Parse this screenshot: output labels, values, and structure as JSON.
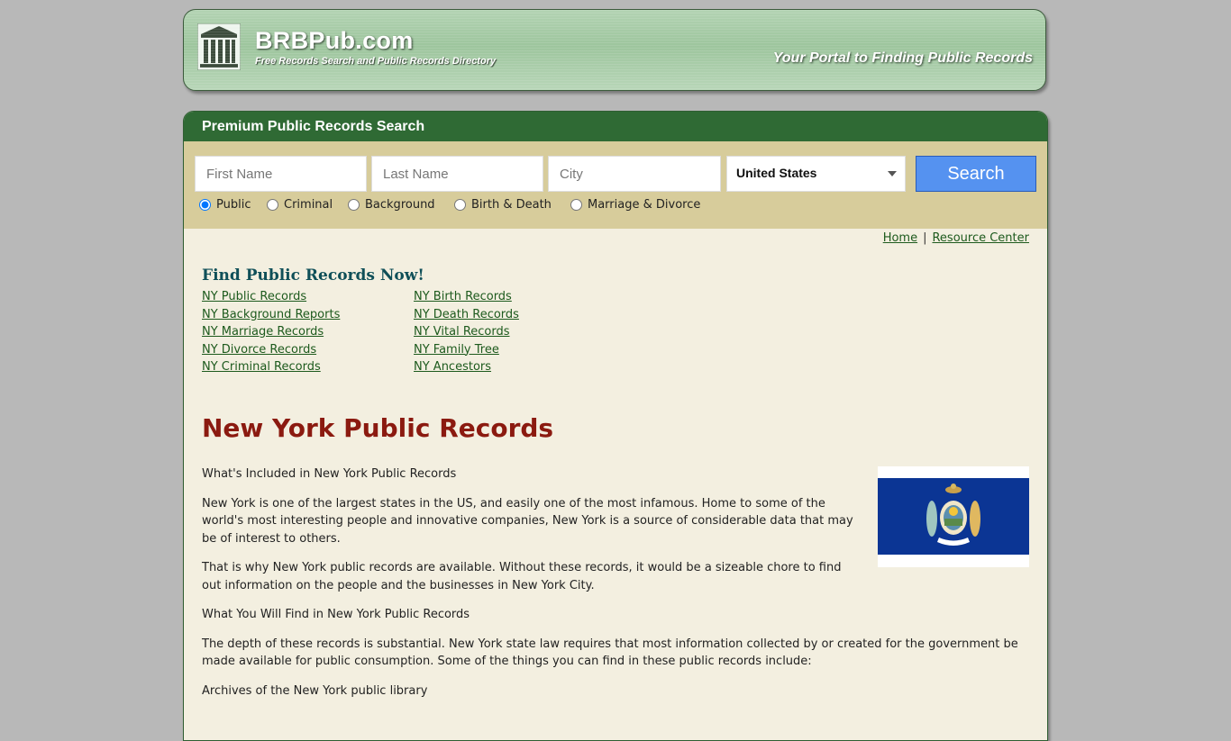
{
  "header": {
    "site_name": "BRBPub.com",
    "tagline": "Free Records Search and Public Records Directory",
    "portal_text": "Your Portal to Finding Public Records"
  },
  "search": {
    "title": "Premium Public Records Search",
    "first_name_placeholder": "First Name",
    "last_name_placeholder": "Last Name",
    "city_placeholder": "City",
    "state_selected": "United States",
    "button_label": "Search",
    "record_types": [
      {
        "label": "Public",
        "checked": true
      },
      {
        "label": "Criminal",
        "checked": false
      },
      {
        "label": "Background",
        "checked": false
      },
      {
        "label": "Birth & Death",
        "checked": false
      },
      {
        "label": "Marriage & Divorce",
        "checked": false
      }
    ]
  },
  "nav": {
    "home": "Home",
    "separator": "|",
    "resource_center": "Resource Center"
  },
  "find": {
    "title": "Find Public Records Now!",
    "left_links": [
      "NY Public Records",
      "NY Background Reports",
      "NY Marriage Records",
      "NY Divorce Records",
      "NY Criminal Records"
    ],
    "right_links": [
      "NY Birth Records",
      "NY Death Records",
      "NY Vital Records",
      "NY Family Tree",
      "NY Ancestors"
    ]
  },
  "article": {
    "title": "New York Public Records",
    "p1": "What's Included in New York Public Records",
    "p2": "New York is one of the largest states in the US, and easily one of the most infamous. Home to some of the world's most interesting people and innovative companies, New York is a source of considerable data that may be of interest to others.",
    "p3": "That is why New York public records are available. Without these records, it would be a sizeable chore to find out information on the people and the businesses in New York City.",
    "p4": "What You Will Find in New York Public Records",
    "p5": "The depth of these records is substantial. New York state law requires that most information collected by or created for the government be made available for public consumption. Some of the things you can find in these public records include:",
    "p6": "Archives of the New York public library"
  },
  "colors": {
    "page_bg": "#b8b8b8",
    "header_green": "#9dc59d",
    "search_bar_green": "#2f6a34",
    "search_area_tan": "#d7cc9b",
    "content_bg": "#f3efe0",
    "title_red": "#8b1a10",
    "link_green": "#1d5a1d",
    "button_blue": "#5592f0",
    "flag_blue": "#0b3594"
  }
}
